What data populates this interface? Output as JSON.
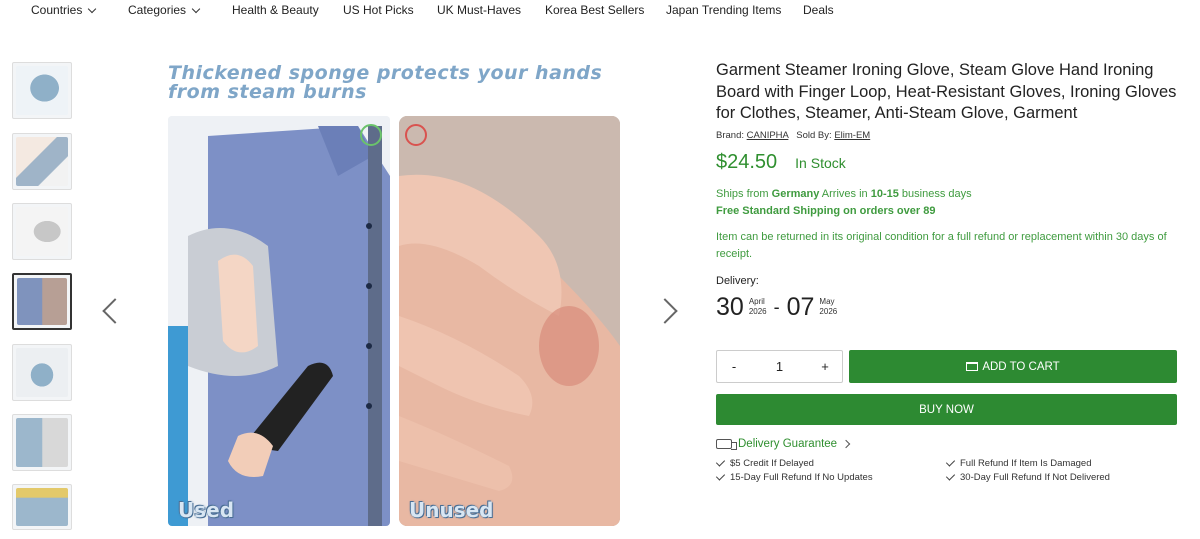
{
  "nav": {
    "items": [
      {
        "label": "Countries",
        "dropdown": true
      },
      {
        "label": "Categories",
        "dropdown": true
      },
      {
        "label": "Health & Beauty"
      },
      {
        "label": "US Hot Picks"
      },
      {
        "label": "UK Must-Haves"
      },
      {
        "label": "Korea Best Sellers"
      },
      {
        "label": "Japan Trending Items"
      },
      {
        "label": "Deals"
      }
    ]
  },
  "gallery": {
    "headline_line1": "Thickened sponge protects your hands",
    "headline_line2": "from steam burns",
    "used_label": "Used",
    "unused_label": "Unused",
    "thumbnail_count": 7,
    "active_thumbnail": 4
  },
  "product": {
    "title": "Garment Steamer Ironing Glove, Steam Glove Hand Ironing Board with Finger Loop, Heat-Resistant Gloves, Ironing Gloves for Clothes, Steamer, Anti-Steam Glove, Garment",
    "brand_label": "Brand:",
    "brand": "CANIPHA",
    "sold_by_label": "Sold By:",
    "seller": "Elim-EM",
    "price": "$24.50",
    "stock": "In Stock",
    "ships_from_prefix": "Ships from",
    "ships_from": "Germany",
    "arrives_prefix": "Arrives in",
    "arrives_days": "10-15",
    "arrives_suffix": "business days",
    "free_shipping": "Free Standard Shipping on orders over 89",
    "returns": "Item can be returned in its original condition for a full refund or replacement within 30 days of receipt.",
    "delivery_label": "Delivery:",
    "delivery_from": {
      "day": "30",
      "month": "April",
      "year": "2026"
    },
    "delivery_to": {
      "day": "07",
      "month": "May",
      "year": "2026"
    },
    "dash": "-"
  },
  "cart": {
    "minus": "-",
    "quantity": "1",
    "plus": "+",
    "add_to_cart": "ADD TO CART",
    "buy_now": "BUY NOW"
  },
  "guarantee": {
    "title": "Delivery Guarantee",
    "items": [
      "$5 Credit If Delayed",
      "Full Refund If Item Is Damaged",
      "15-Day Full Refund If No Updates",
      "30-Day Full Refund If Not Delivered"
    ]
  },
  "colors": {
    "accent_green": "#2d8a32",
    "text_green": "#3f9b3f",
    "headline_blue": "#7fa6c8"
  }
}
